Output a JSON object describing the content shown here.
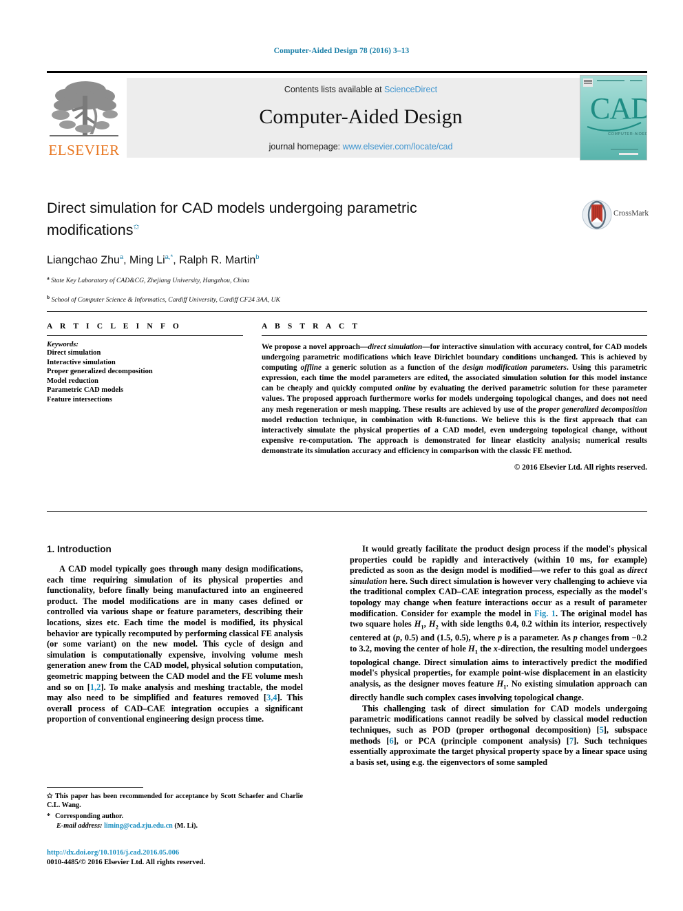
{
  "running_head": "Computer-Aided Design 78 (2016) 3–13",
  "masthead": {
    "contents_prefix": "Contents lists available at ",
    "sciencedirect": "ScienceDirect",
    "journal_title": "Computer-Aided Design",
    "homepage_prefix": "journal homepage: ",
    "homepage_url": "www.elsevier.com/locate/cad",
    "publisher": "ELSEVIER",
    "cover_text": "CAD",
    "cover_subtitle": "COMPUTER-AIDED DESIGN",
    "link_color": "#3f95cf",
    "band_color": "#ededed",
    "publisher_color": "#E87722",
    "cover_color": "#7fcfc8"
  },
  "crossmark": {
    "label": "CrossMark"
  },
  "title": {
    "line1": "Direct simulation for CAD models undergoing parametric",
    "line2": "modifications",
    "star": "✩"
  },
  "authors": {
    "a1_name": "Liangchao Zhu",
    "a1_sup": "a",
    "a2_name": "Ming Li",
    "a2_sup": "a,*",
    "a3_name": "Ralph R. Martin",
    "a3_sup": "b",
    "affiliations": [
      {
        "sup": "a",
        "text": "State Key Laboratory of CAD&CG, Zhejiang University, Hangzhou, China"
      },
      {
        "sup": "b",
        "text": "School of Computer Science & Informatics, Cardiff University, Cardiff CF24 3AA, UK"
      }
    ]
  },
  "article_info": {
    "heading": "A R T I C L E   I N F O",
    "keywords_label": "Keywords:",
    "keywords": [
      "Direct simulation",
      "Interactive simulation",
      "Proper generalized decomposition",
      "Model reduction",
      "Parametric CAD models",
      "Feature intersections"
    ]
  },
  "abstract": {
    "heading": "A B S T R A C T",
    "copyright": "© 2016 Elsevier Ltd. All rights reserved."
  },
  "introduction": {
    "section_title": "1. Introduction"
  },
  "footnotes": {
    "note1": "This paper has been recommended for acceptance by Scott Schaefer and Charlie C.L. Wang.",
    "note2": "Corresponding author.",
    "email_label": "E-mail address:",
    "email": "liming@cad.zju.edu.cn",
    "email_suffix": "(M. Li).",
    "doi": "http://dx.doi.org/10.1016/j.cad.2016.05.006",
    "issn_line": "0010-4485/© 2016 Elsevier Ltd. All rights reserved."
  }
}
